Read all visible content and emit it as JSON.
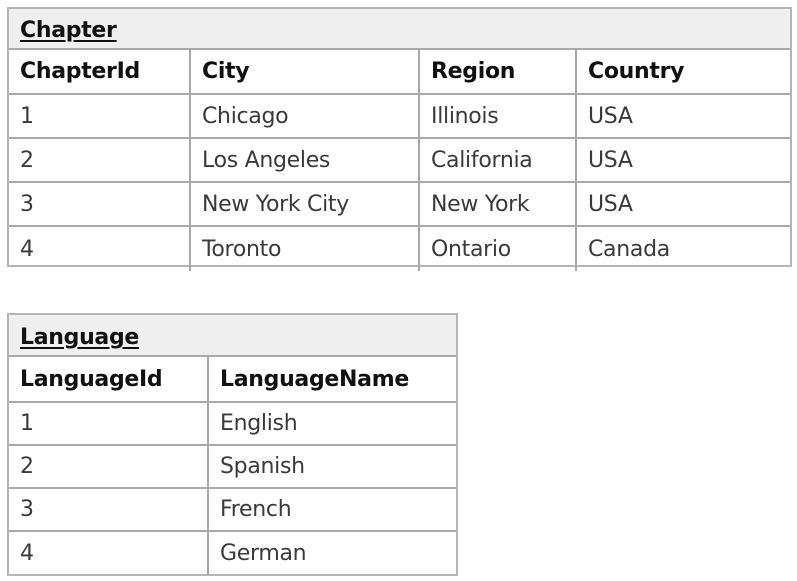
{
  "tables": {
    "chapter": {
      "title": "Chapter",
      "columns": [
        "ChapterId",
        "City",
        "Region",
        "Country"
      ],
      "rows": [
        [
          "1",
          "Chicago",
          "Illinois",
          "USA"
        ],
        [
          "2",
          "Los Angeles",
          "California",
          "USA"
        ],
        [
          "3",
          "New York City",
          "New York",
          "USA"
        ],
        [
          "4",
          "Toronto",
          "Ontario",
          "Canada"
        ]
      ]
    },
    "language": {
      "title": "Language",
      "columns": [
        "LanguageId",
        "LanguageName"
      ],
      "rows": [
        [
          "1",
          "English"
        ],
        [
          "2",
          "Spanish"
        ],
        [
          "3",
          "French"
        ],
        [
          "4",
          "German"
        ]
      ]
    }
  }
}
